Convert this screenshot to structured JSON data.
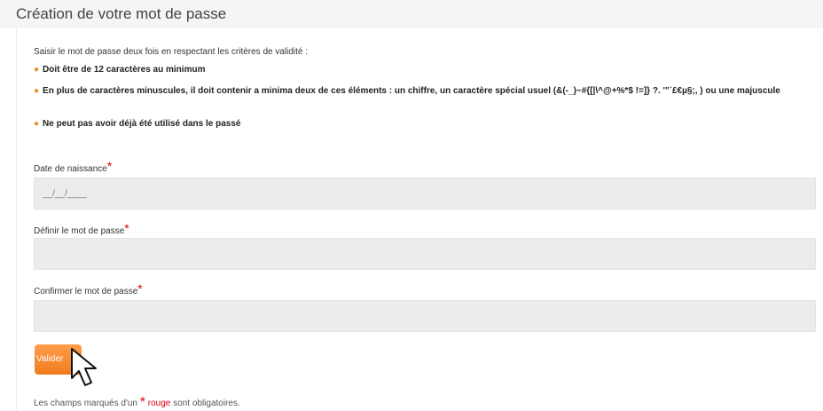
{
  "header": {
    "title": "Création de votre mot de passe"
  },
  "intro": "Saisir le mot de passe deux fois en respectant les critères de validité :",
  "criteria": [
    "Doit être de 12 caractères au minimum",
    "En plus de caractères minuscules, il doit contenir a minima deux de ces éléments : un chiffre, un caractère spécial usuel (&(-_)~#{[|\\^@+%*$ !=]} ?. '\"`£€µ§;, ) ou une majuscule",
    "Ne peut pas avoir déjà été utilisé dans le passé"
  ],
  "form": {
    "birthdate": {
      "label": "Date de naissance",
      "placeholder": "__/__/____"
    },
    "password": {
      "label": "Définir le mot de passe",
      "value": ""
    },
    "confirm": {
      "label": "Confirmer le mot de passe",
      "value": ""
    },
    "required_mark": "*",
    "submit_label": "Valider"
  },
  "footer": {
    "prefix": "Les champs marqués d'un",
    "star": "*",
    "color_word": "rouge",
    "suffix": "sont obligatoires."
  },
  "colors": {
    "accent": "#f08a24",
    "required": "#e0000f",
    "input_bg": "#ececec"
  },
  "icons": [
    "bullet-dot-icon",
    "mouse-pointer-icon"
  ]
}
